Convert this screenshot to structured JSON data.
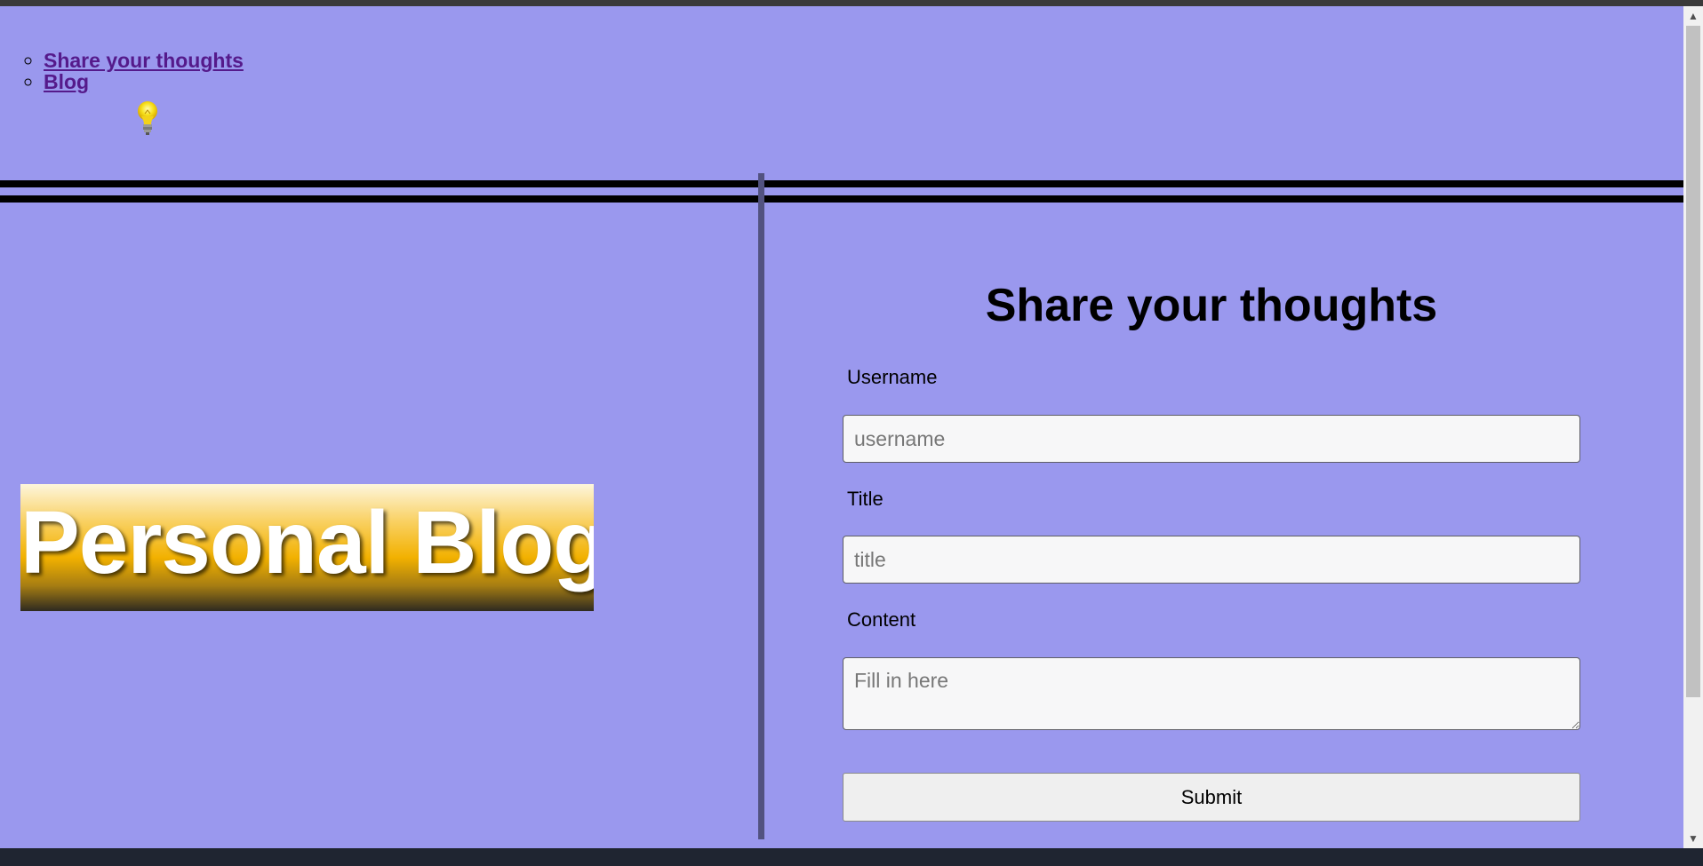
{
  "nav": {
    "links": [
      "Share your thoughts",
      "Blog"
    ]
  },
  "decor": {
    "bulb_icon": "lightbulb-icon",
    "accent": "#9a98ee"
  },
  "banner": {
    "text": "Personal Blog"
  },
  "form": {
    "title": "Share your thoughts",
    "username_label": "Username",
    "username_placeholder": "username",
    "title_label": "Title",
    "title_placeholder": "title",
    "content_label": "Content",
    "content_placeholder": "Fill in here",
    "submit_label": "Submit"
  }
}
